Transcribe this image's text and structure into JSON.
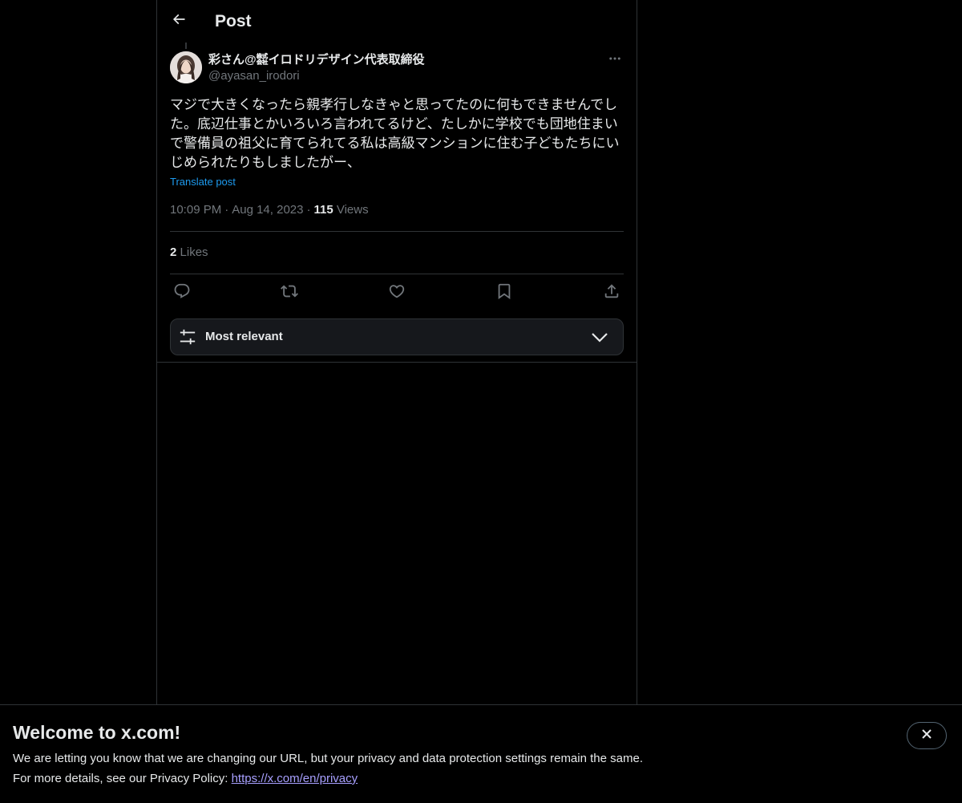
{
  "header": {
    "title": "Post",
    "back_icon": "arrow-left-icon"
  },
  "post": {
    "author_name": "彩さん@㍿イロドリデザイン代表取締役",
    "author_handle": "@ayasan_irodori",
    "text": "マジで大きくなったら親孝行しなきゃと思ってたのに何もできませんでした。底辺仕事とかいろいろ言われてるけど、たしかに学校でも団地住まいで警備員の祖父に育てられてる私は高級マンションに住む子どもたちにいじめられたりもしましたがー、",
    "translate_label": "Translate post",
    "time": "10:09 PM",
    "separator": "·",
    "date": "Aug 14, 2023",
    "views_count": "115",
    "views_label": "Views",
    "likes_count": "2",
    "likes_label": "Likes"
  },
  "actions": {
    "reply_icon": "reply-icon",
    "repost_icon": "repost-icon",
    "like_icon": "heart-icon",
    "bookmark_icon": "bookmark-icon",
    "share_icon": "share-icon"
  },
  "sort": {
    "label": "Most relevant",
    "icon": "sliders-icon"
  },
  "banner": {
    "title": "Welcome to x.com!",
    "line1": "We are letting you know that we are changing our URL, but your privacy and data protection settings remain the same.",
    "line2_prefix": "For more details, see our Privacy Policy: ",
    "link": "https://x.com/en/privacy"
  },
  "colors": {
    "background": "#000000",
    "text": "#e7e9ea",
    "muted": "#71767b",
    "link": "#1d9bf0",
    "border": "#2f3336"
  }
}
